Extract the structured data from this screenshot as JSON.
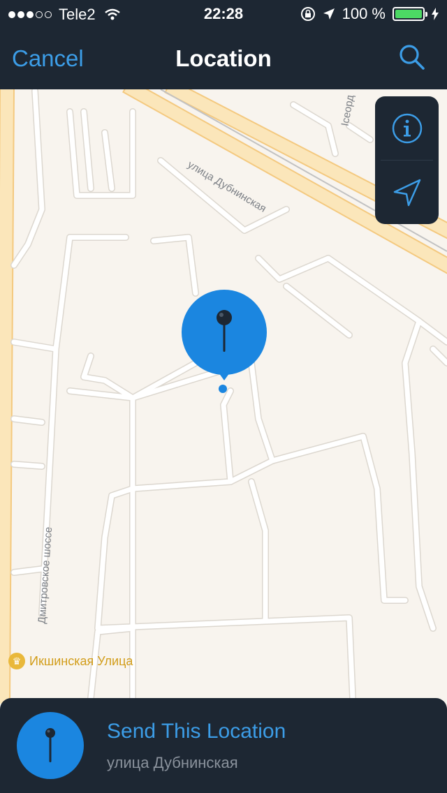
{
  "status_bar": {
    "carrier": "Tele2",
    "signal_bars_filled": 3,
    "signal_bars_total": 5,
    "time": "22:28",
    "battery_text": "100 %",
    "battery_level": 1.0,
    "battery_color": "#4cd964"
  },
  "nav_bar": {
    "cancel_label": "Cancel",
    "title": "Location"
  },
  "map": {
    "street_labels": {
      "dubninskaya": "улица Дубнинская",
      "dmitrovskoe": "Дмитровское шоссе",
      "partial_top": "Ісеорд"
    },
    "poi": {
      "name": "Икшинская Улица",
      "icon": "crown-icon"
    },
    "controls": [
      "info-icon",
      "location-arrow-icon"
    ]
  },
  "bottom_panel": {
    "send_label": "Send This Location",
    "address": "улица Дубнинская"
  },
  "colors": {
    "bar_background": "#1d2733",
    "accent": "#3c9de7",
    "pin_blue": "#1b86e0",
    "map_background": "#f8f4ee",
    "major_road": "#f9d99b"
  }
}
